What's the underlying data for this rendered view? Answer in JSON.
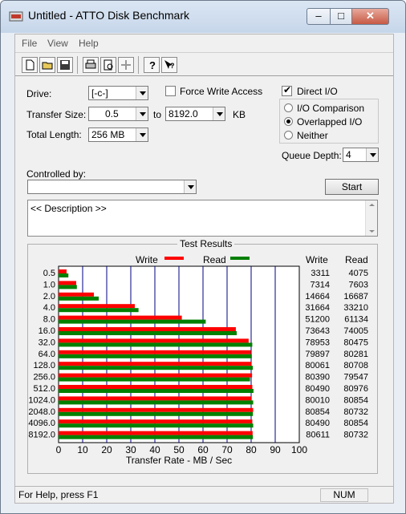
{
  "window": {
    "title": "Untitled - ATTO Disk Benchmark"
  },
  "menu": [
    "File",
    "View",
    "Help"
  ],
  "toolbar_icons": [
    "new-icon",
    "open-icon",
    "save-icon",
    "print-icon",
    "print-preview-icon",
    "move-icon",
    "help-icon",
    "context-help-icon"
  ],
  "form": {
    "drive_label": "Drive:",
    "drive_value": "[-c-]",
    "force_write_label": "Force Write Access",
    "force_write_checked": false,
    "direct_io_label": "Direct I/O",
    "direct_io_checked": true,
    "transfer_size_label": "Transfer Size:",
    "transfer_from": "0.5",
    "to_label": "to",
    "transfer_to": "8192.0",
    "kb_label": "KB",
    "total_length_label": "Total Length:",
    "total_length_value": "256 MB",
    "io_options": [
      {
        "label": "I/O Comparison",
        "selected": false
      },
      {
        "label": "Overlapped I/O",
        "selected": true
      },
      {
        "label": "Neither",
        "selected": false
      }
    ],
    "queue_depth_label": "Queue Depth:",
    "queue_depth_value": "4",
    "controlled_by_label": "Controlled by:",
    "controlled_by_value": "",
    "start_label": "Start",
    "description": "<< Description >>"
  },
  "results": {
    "title": "Test Results",
    "write_legend": "Write",
    "read_legend": "Read",
    "write_col": "Write",
    "read_col": "Read",
    "write_color": "#ff0000",
    "read_color": "#008000"
  },
  "chart_data": {
    "type": "bar",
    "orientation": "horizontal",
    "categories": [
      "0.5",
      "1.0",
      "2.0",
      "4.0",
      "8.0",
      "16.0",
      "32.0",
      "64.0",
      "128.0",
      "256.0",
      "512.0",
      "1024.0",
      "2048.0",
      "4096.0",
      "8192.0"
    ],
    "series": [
      {
        "name": "Write",
        "values": [
          3311,
          7314,
          14664,
          31664,
          51200,
          73643,
          78953,
          79897,
          80061,
          80390,
          80490,
          80010,
          80854,
          80490,
          80611
        ]
      },
      {
        "name": "Read",
        "values": [
          4075,
          7603,
          16687,
          33210,
          61134,
          74005,
          80475,
          80281,
          80708,
          79547,
          80976,
          80854,
          80732,
          80854,
          80732
        ]
      }
    ],
    "xlabel": "Transfer Rate - MB / Sec",
    "xticks": [
      "0",
      "10",
      "20",
      "30",
      "40",
      "50",
      "60",
      "70",
      "80",
      "90",
      "100"
    ],
    "xlim": [
      0,
      100
    ],
    "grid": true,
    "legend": "top"
  },
  "status": {
    "help_text": "For Help, press F1",
    "num": "NUM"
  }
}
